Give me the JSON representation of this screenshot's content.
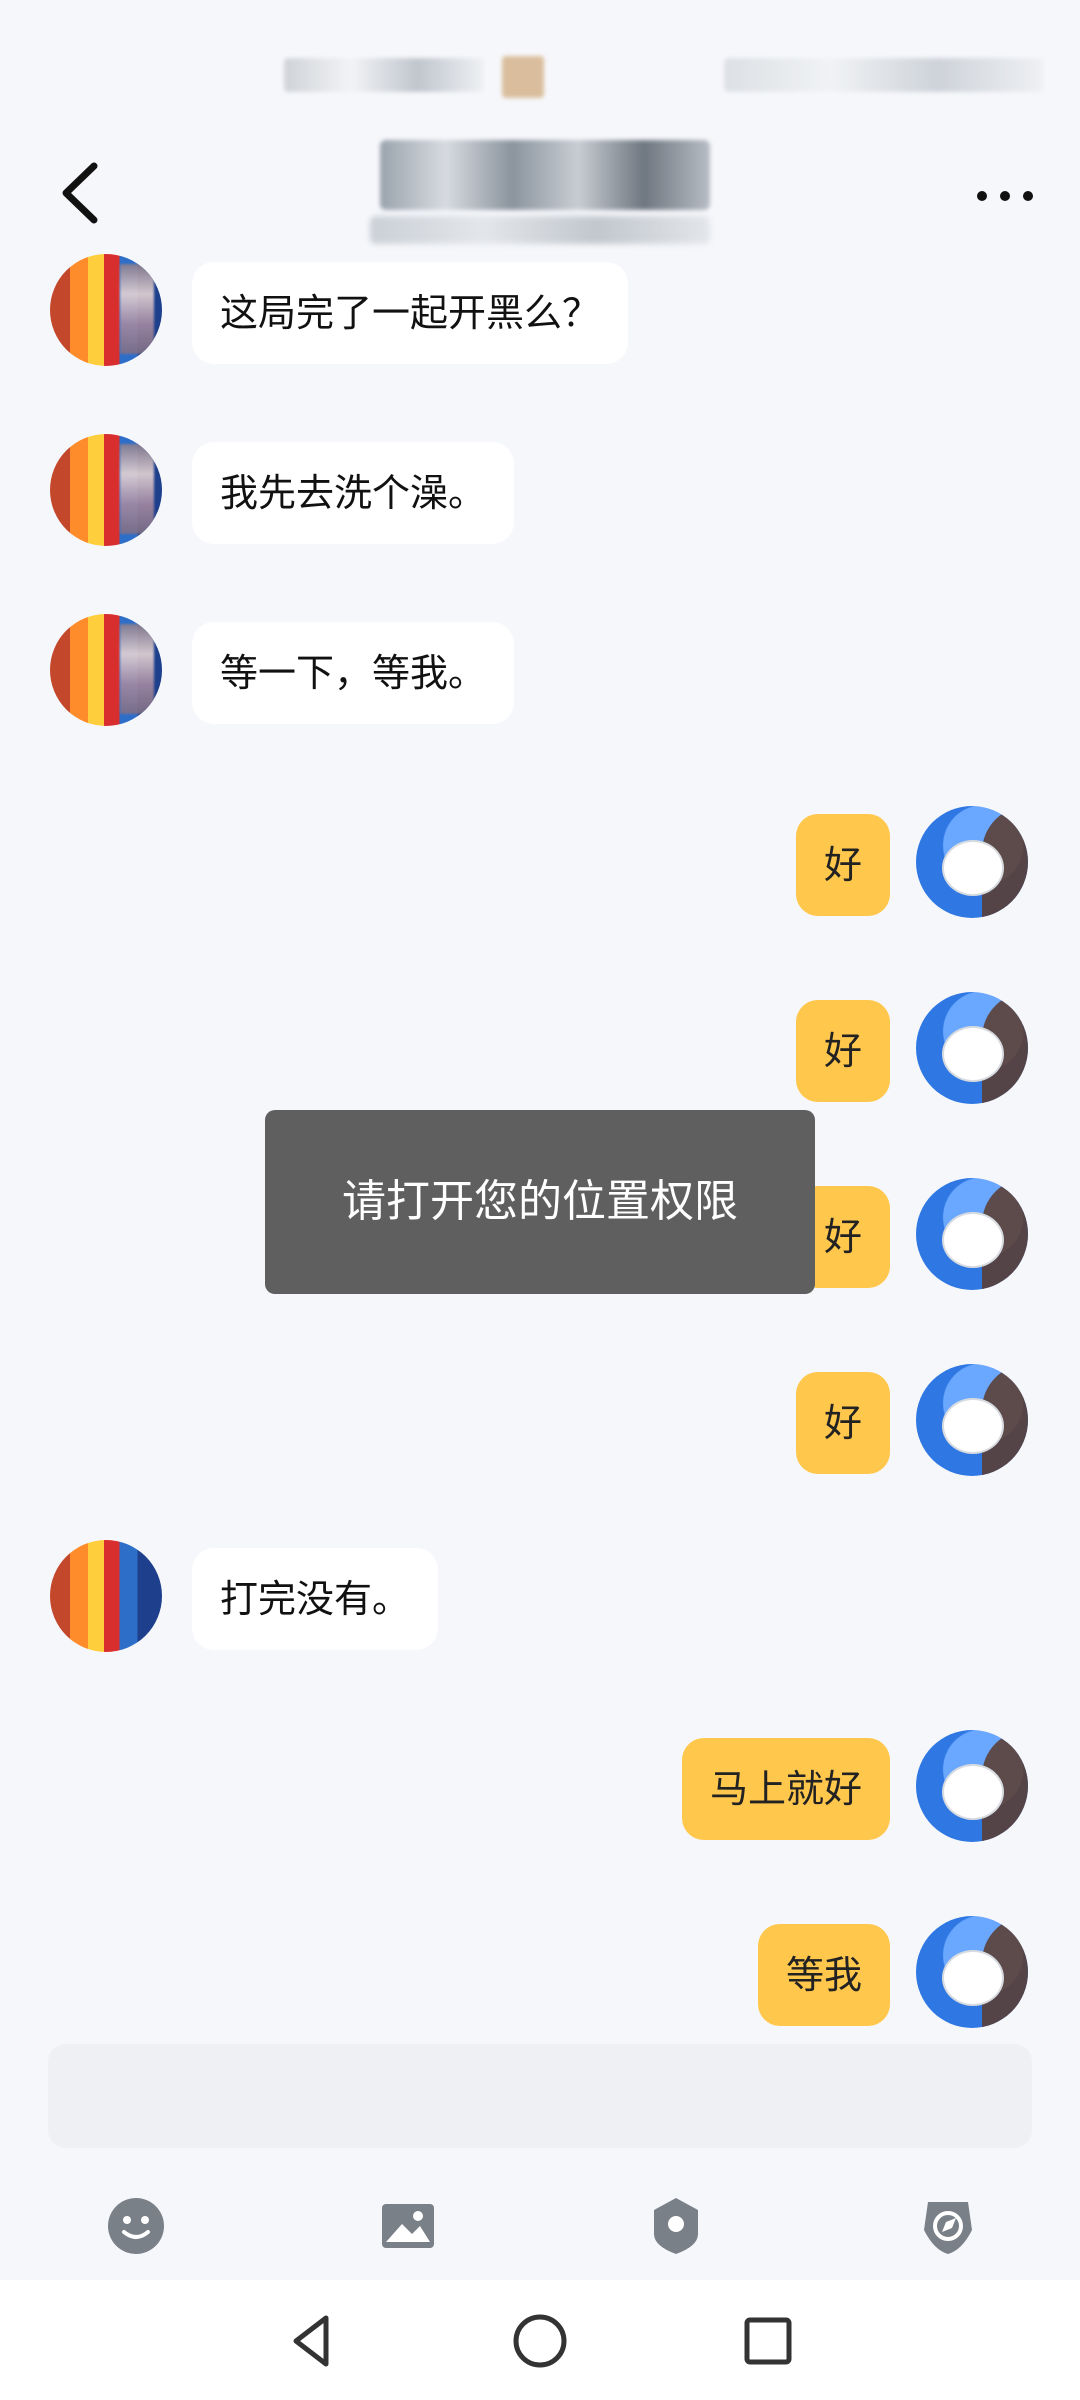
{
  "header": {
    "back_icon": "chevron-left-icon",
    "more_icon": "more-horizontal-icon"
  },
  "messages": [
    {
      "side": "left",
      "avatar": "pencils-avatar",
      "text": "这局完了一起开黑么？"
    },
    {
      "side": "left",
      "avatar": "pencils-avatar",
      "text": "我先去洗个澡。"
    },
    {
      "side": "left",
      "avatar": "pencils-avatar",
      "text": "等一下，等我。"
    },
    {
      "side": "right",
      "avatar": "cat-avatar",
      "text": "好"
    },
    {
      "side": "right",
      "avatar": "cat-avatar",
      "text": "好"
    },
    {
      "side": "right",
      "avatar": "cat-avatar",
      "text": "好"
    },
    {
      "side": "right",
      "avatar": "cat-avatar",
      "text": "好"
    },
    {
      "side": "left",
      "avatar": "pencils-avatar",
      "text": "打完没有。"
    },
    {
      "side": "right",
      "avatar": "cat-avatar",
      "text": "马上就好"
    },
    {
      "side": "right",
      "avatar": "cat-avatar",
      "text": "等我"
    }
  ],
  "toast": {
    "text": "请打开您的位置权限"
  },
  "toolbar": {
    "items": [
      "emoji-icon",
      "image-icon",
      "location-shield-icon",
      "compass-icon"
    ]
  },
  "navbar": {
    "items": [
      "back-triangle-icon",
      "home-circle-icon",
      "recents-square-icon"
    ]
  },
  "colors": {
    "background": "#f6f7fb",
    "my_bubble": "#ffc84c",
    "their_bubble": "#ffffff",
    "toast": "#5f5f5f"
  }
}
